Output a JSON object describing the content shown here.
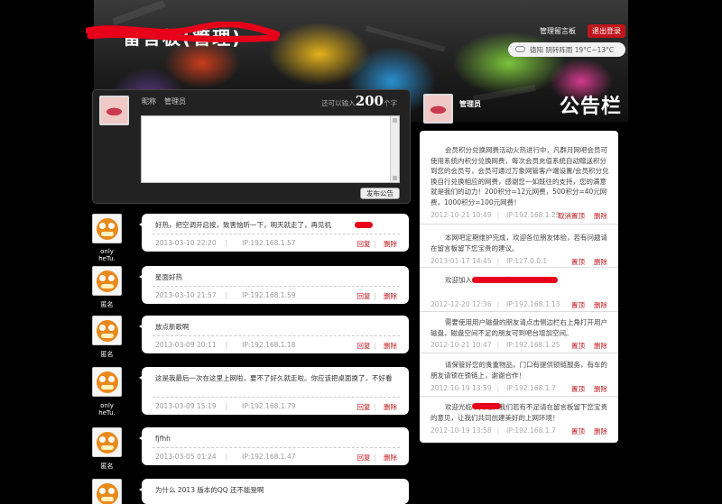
{
  "header": {
    "site_title": "留言板(管理)",
    "admin_link": "管理留言板",
    "logout_button": "退出登录",
    "weather": "德阳  阴转阵雨  19°C~13°C"
  },
  "post_form": {
    "nickname_label": "昵称",
    "nickname_value": "管理员",
    "counter_prefix": "还可以输入",
    "counter_value": "200",
    "counter_suffix": "个字",
    "submit_label": "发布公告"
  },
  "messages": [
    {
      "author": "only heTu.",
      "text": "好热，把空调开启按，致害恼昕一下，明天就走了，再见机",
      "time": "2013-03-10 22:20",
      "ip": "IP:192.168.1.57",
      "reply": "回复",
      "delete": "删除"
    },
    {
      "author": "匿名",
      "text": "星面好热",
      "time": "2013-03-10 21:57",
      "ip": "IP:192.168.1.59",
      "reply": "回复",
      "delete": "删除"
    },
    {
      "author": "匿名",
      "text": "放点新歌啊",
      "time": "2013-03-09 20:11",
      "ip": "IP:192.168.1.18",
      "reply": "回复",
      "delete": "删除"
    },
    {
      "author": "only heTu.",
      "text": "这是我最后一次在这里上网啦，要不了好久就走啦。你应该把桌面换了，不好看",
      "time": "2013-03-09 15:19",
      "ip": "IP:192.168.1.79",
      "reply": "回复",
      "delete": "删除"
    },
    {
      "author": "匿名",
      "text": "fjfhh",
      "time": "2013-03-05 01:24",
      "ip": "IP:192.168.1.47",
      "reply": "回复",
      "delete": "删除"
    },
    {
      "author": "匿名",
      "text": "为什么 2013 版本的QQ 还不能登啊",
      "time": "",
      "ip": "",
      "reply": "",
      "delete": ""
    }
  ],
  "announcements": {
    "title": "公告栏",
    "author": "管理员",
    "items": [
      {
        "text": "会员积分兑换网费活动火热进行中，凡群月网吧会员可使用系统内积分兑换网费，每次会员充值系统自动赠送积分到您的会员号，会员可通过万象网管客户端设置/会员积分兑换自行兑换相应的网费，感谢您一如既往的支持，您的满意就是我们的动力！200积分=12元网费，500积分=40元网费，1000积分=100元网费！",
        "time": "2012-10-21 10:49",
        "ip": "IP:192.168.1.25",
        "actions": [
          "取消置顶",
          "删除"
        ]
      },
      {
        "text": "本网吧定期维护完成，欢迎各位朋友体验，若有问题请在留言板留下您宝贵的建议。",
        "time": "2013-01-17 14:45",
        "ip": "IP:127.0.0.1",
        "actions": [
          "置顶",
          "删除"
        ]
      },
      {
        "text": "欢迎加入本网吧QQ群：208413645",
        "time": "2012-12-20 12:36",
        "ip": "IP:192.168.1.13",
        "actions": [
          "置顶",
          "删除"
        ]
      },
      {
        "text": "需要使用用户磁盘的朋友请点击侧边栏右上角打开用户磁盘，磁盘空间不足的朋友可到吧台增加空间。",
        "time": "2012-10-21 10:47",
        "ip": "IP:192.168.1.25",
        "actions": [
          "置顶",
          "删除"
        ]
      },
      {
        "text": "请保管好您的贵重物品，门口有提供锁链服务，有车的朋友请锁在锁链上，谢谢合作！",
        "time": "2012-10-19 13:59",
        "ip": "IP:192.168.1.7",
        "actions": [
          "置顶",
          "删除"
        ]
      },
      {
        "text": "欢迎光临本网吧，我们若有不足请在留言板留下您宝贵的意见，让我们共同创建美好的上网环境！",
        "time": "2012-10-19 13:58",
        "ip": "IP:192.168.1.7",
        "actions": [
          "置顶",
          "删除"
        ]
      }
    ]
  },
  "colors": {
    "accent_red": "#c0161b",
    "background": "#000000",
    "panel": "#222222"
  }
}
